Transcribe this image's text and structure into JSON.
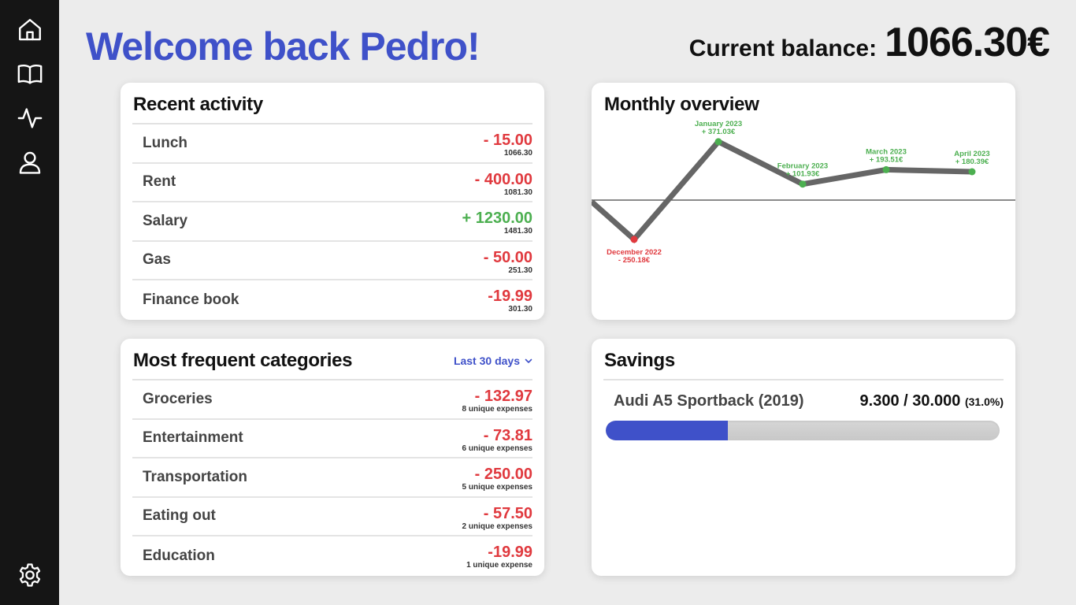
{
  "sidebar": {
    "items": [
      {
        "icon": "home-icon"
      },
      {
        "icon": "book-icon"
      },
      {
        "icon": "activity-icon"
      },
      {
        "icon": "user-icon"
      }
    ],
    "settings_icon": "gear-icon"
  },
  "header": {
    "welcome": "Welcome back Pedro!",
    "balance_label": "Current balance:",
    "balance_value": "1066.30€"
  },
  "recent_activity": {
    "title": "Recent activity",
    "rows": [
      {
        "label": "Lunch",
        "amount": "- 15.00",
        "sub": "1066.30"
      },
      {
        "label": "Rent",
        "amount": "- 400.00",
        "sub": "1081.30"
      },
      {
        "label": "Salary",
        "amount": "+ 1230.00",
        "sub": "1481.30"
      },
      {
        "label": "Gas",
        "amount": "- 50.00",
        "sub": "251.30"
      },
      {
        "label": "Finance book",
        "amount": "-19.99",
        "sub": "301.30"
      }
    ]
  },
  "categories": {
    "title": "Most frequent categories",
    "filter_label": "Last 30 days",
    "rows": [
      {
        "label": "Groceries",
        "amount": "- 132.97",
        "sub": "8 unique expenses"
      },
      {
        "label": "Entertainment",
        "amount": "- 73.81",
        "sub": "6 unique expenses"
      },
      {
        "label": "Transportation",
        "amount": "- 250.00",
        "sub": "5 unique expenses"
      },
      {
        "label": "Eating out",
        "amount": "- 57.50",
        "sub": "2 unique expenses"
      },
      {
        "label": "Education",
        "amount": "-19.99",
        "sub": "1 unique expense"
      }
    ]
  },
  "overview": {
    "title": "Monthly overview"
  },
  "savings": {
    "title": "Savings",
    "goal_name": "Audi A5 Sportback (2019)",
    "goal_amount": "9.300 / 30.000",
    "goal_percent": "(31.0%)",
    "progress": 0.31
  },
  "colors": {
    "accent": "#3f51c9",
    "negative": "#e0393e",
    "positive": "#4caf50",
    "line": "#666666"
  },
  "chart_data": {
    "type": "line",
    "x": [
      "December 2022",
      "January 2023",
      "February 2023",
      "March 2023",
      "April 2023"
    ],
    "values": [
      -250.18,
      371.03,
      101.93,
      193.51,
      180.39
    ],
    "point_labels": [
      "- 250.18€",
      "+ 371.03€",
      "+ 101.93€",
      "+ 193.51€",
      "+ 180.39€"
    ],
    "baseline": 0,
    "grid": false,
    "legend": "none"
  }
}
